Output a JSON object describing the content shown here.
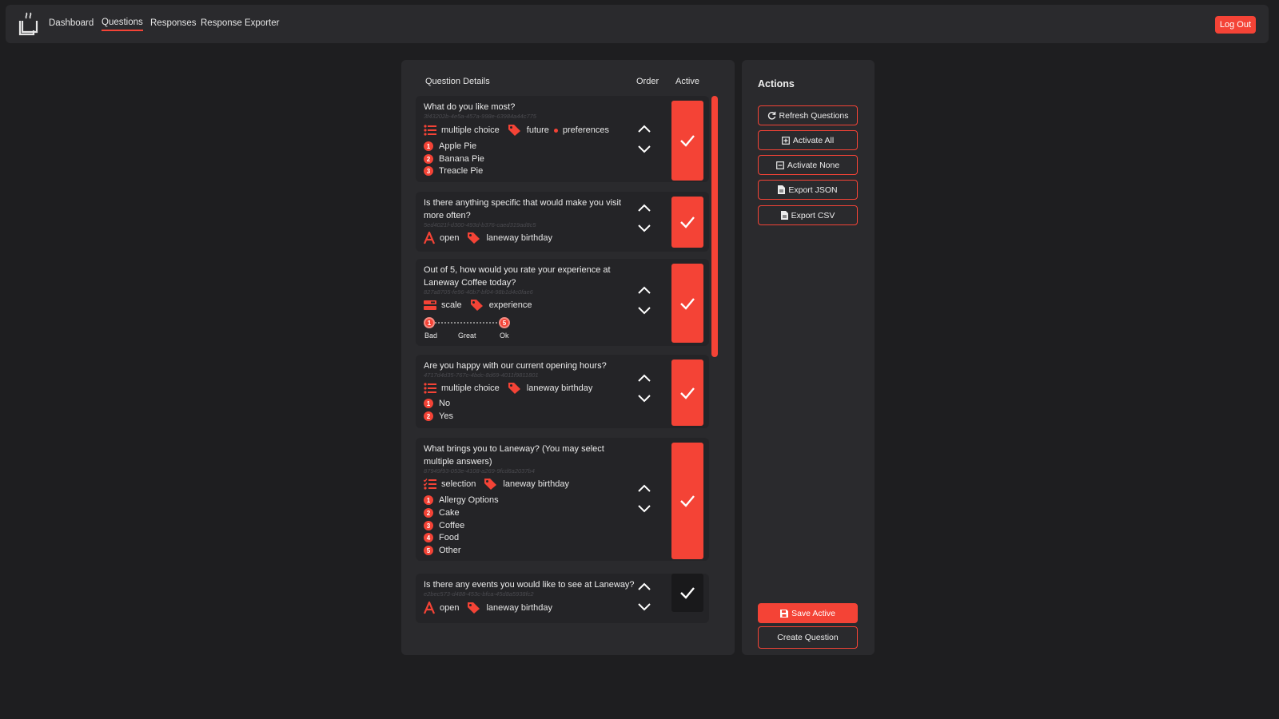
{
  "nav": {
    "links": [
      "Dashboard",
      "Questions",
      "Responses",
      "Response Exporter"
    ],
    "active": "Questions",
    "logout_label": "Log Out"
  },
  "questions_panel": {
    "header": {
      "details": "Question Details",
      "order": "Order",
      "active": "Active"
    },
    "questions": [
      {
        "title": "What do you like most?",
        "id": "3f43202b-4e5a-457a-998e-63984a44c775",
        "type": "multiple choice",
        "tags": [
          "future",
          "preferences"
        ],
        "options": [
          "Apple Pie",
          "Banana Pie",
          "Treacle Pie"
        ],
        "active": true
      },
      {
        "title": "Is there anything specific that would make you visit more often?",
        "id": "5ed4021f-d300-493d-b376-caed319ad8c5",
        "type": "open",
        "tags": [
          "laneway birthday"
        ],
        "active": true
      },
      {
        "title": "Out of 5, how would you rate your experience at Laneway Coffee today?",
        "id": "827a8705-fe96-40b7-bf04-98b1d4c0fae6",
        "type": "scale",
        "tags": [
          "experience"
        ],
        "scale": {
          "min": "1",
          "max": "5",
          "labels": [
            "Bad",
            "Great",
            "Ok"
          ]
        },
        "active": true
      },
      {
        "title": "Are you happy with our current opening hours?",
        "id": "4717d4d35-767c-4bdc-8d69-4011f9811801",
        "type": "multiple choice",
        "tags": [
          "laneway birthday"
        ],
        "options": [
          "No",
          "Yes"
        ],
        "active": true
      },
      {
        "title": "What brings you to Laneway? (You may select multiple answers)",
        "id": "87949f93-053e-4108-a269-9fcd6a2037b4",
        "type": "selection",
        "tags": [
          "laneway birthday"
        ],
        "options": [
          "Allergy Options",
          "Cake",
          "Coffee",
          "Food",
          "Other"
        ],
        "active": true
      },
      {
        "title": "Is there any events you would like to see at Laneway?",
        "id": "e2bec573-d488-453c-bfca-45d8a5938fc2",
        "type": "open",
        "tags": [
          "laneway birthday"
        ],
        "active": false
      }
    ]
  },
  "actions": {
    "title": "Actions",
    "refresh": "Refresh Questions",
    "activate_all": "Activate All",
    "activate_none": "Activate None",
    "export_json": "Export JSON",
    "export_csv": "Export CSV",
    "save_active": "Save Active",
    "create_question": "Create Question"
  },
  "colors": {
    "accent": "#f44336",
    "background": "#1e1e20",
    "panel": "#2a2a2d",
    "card": "#242427"
  }
}
